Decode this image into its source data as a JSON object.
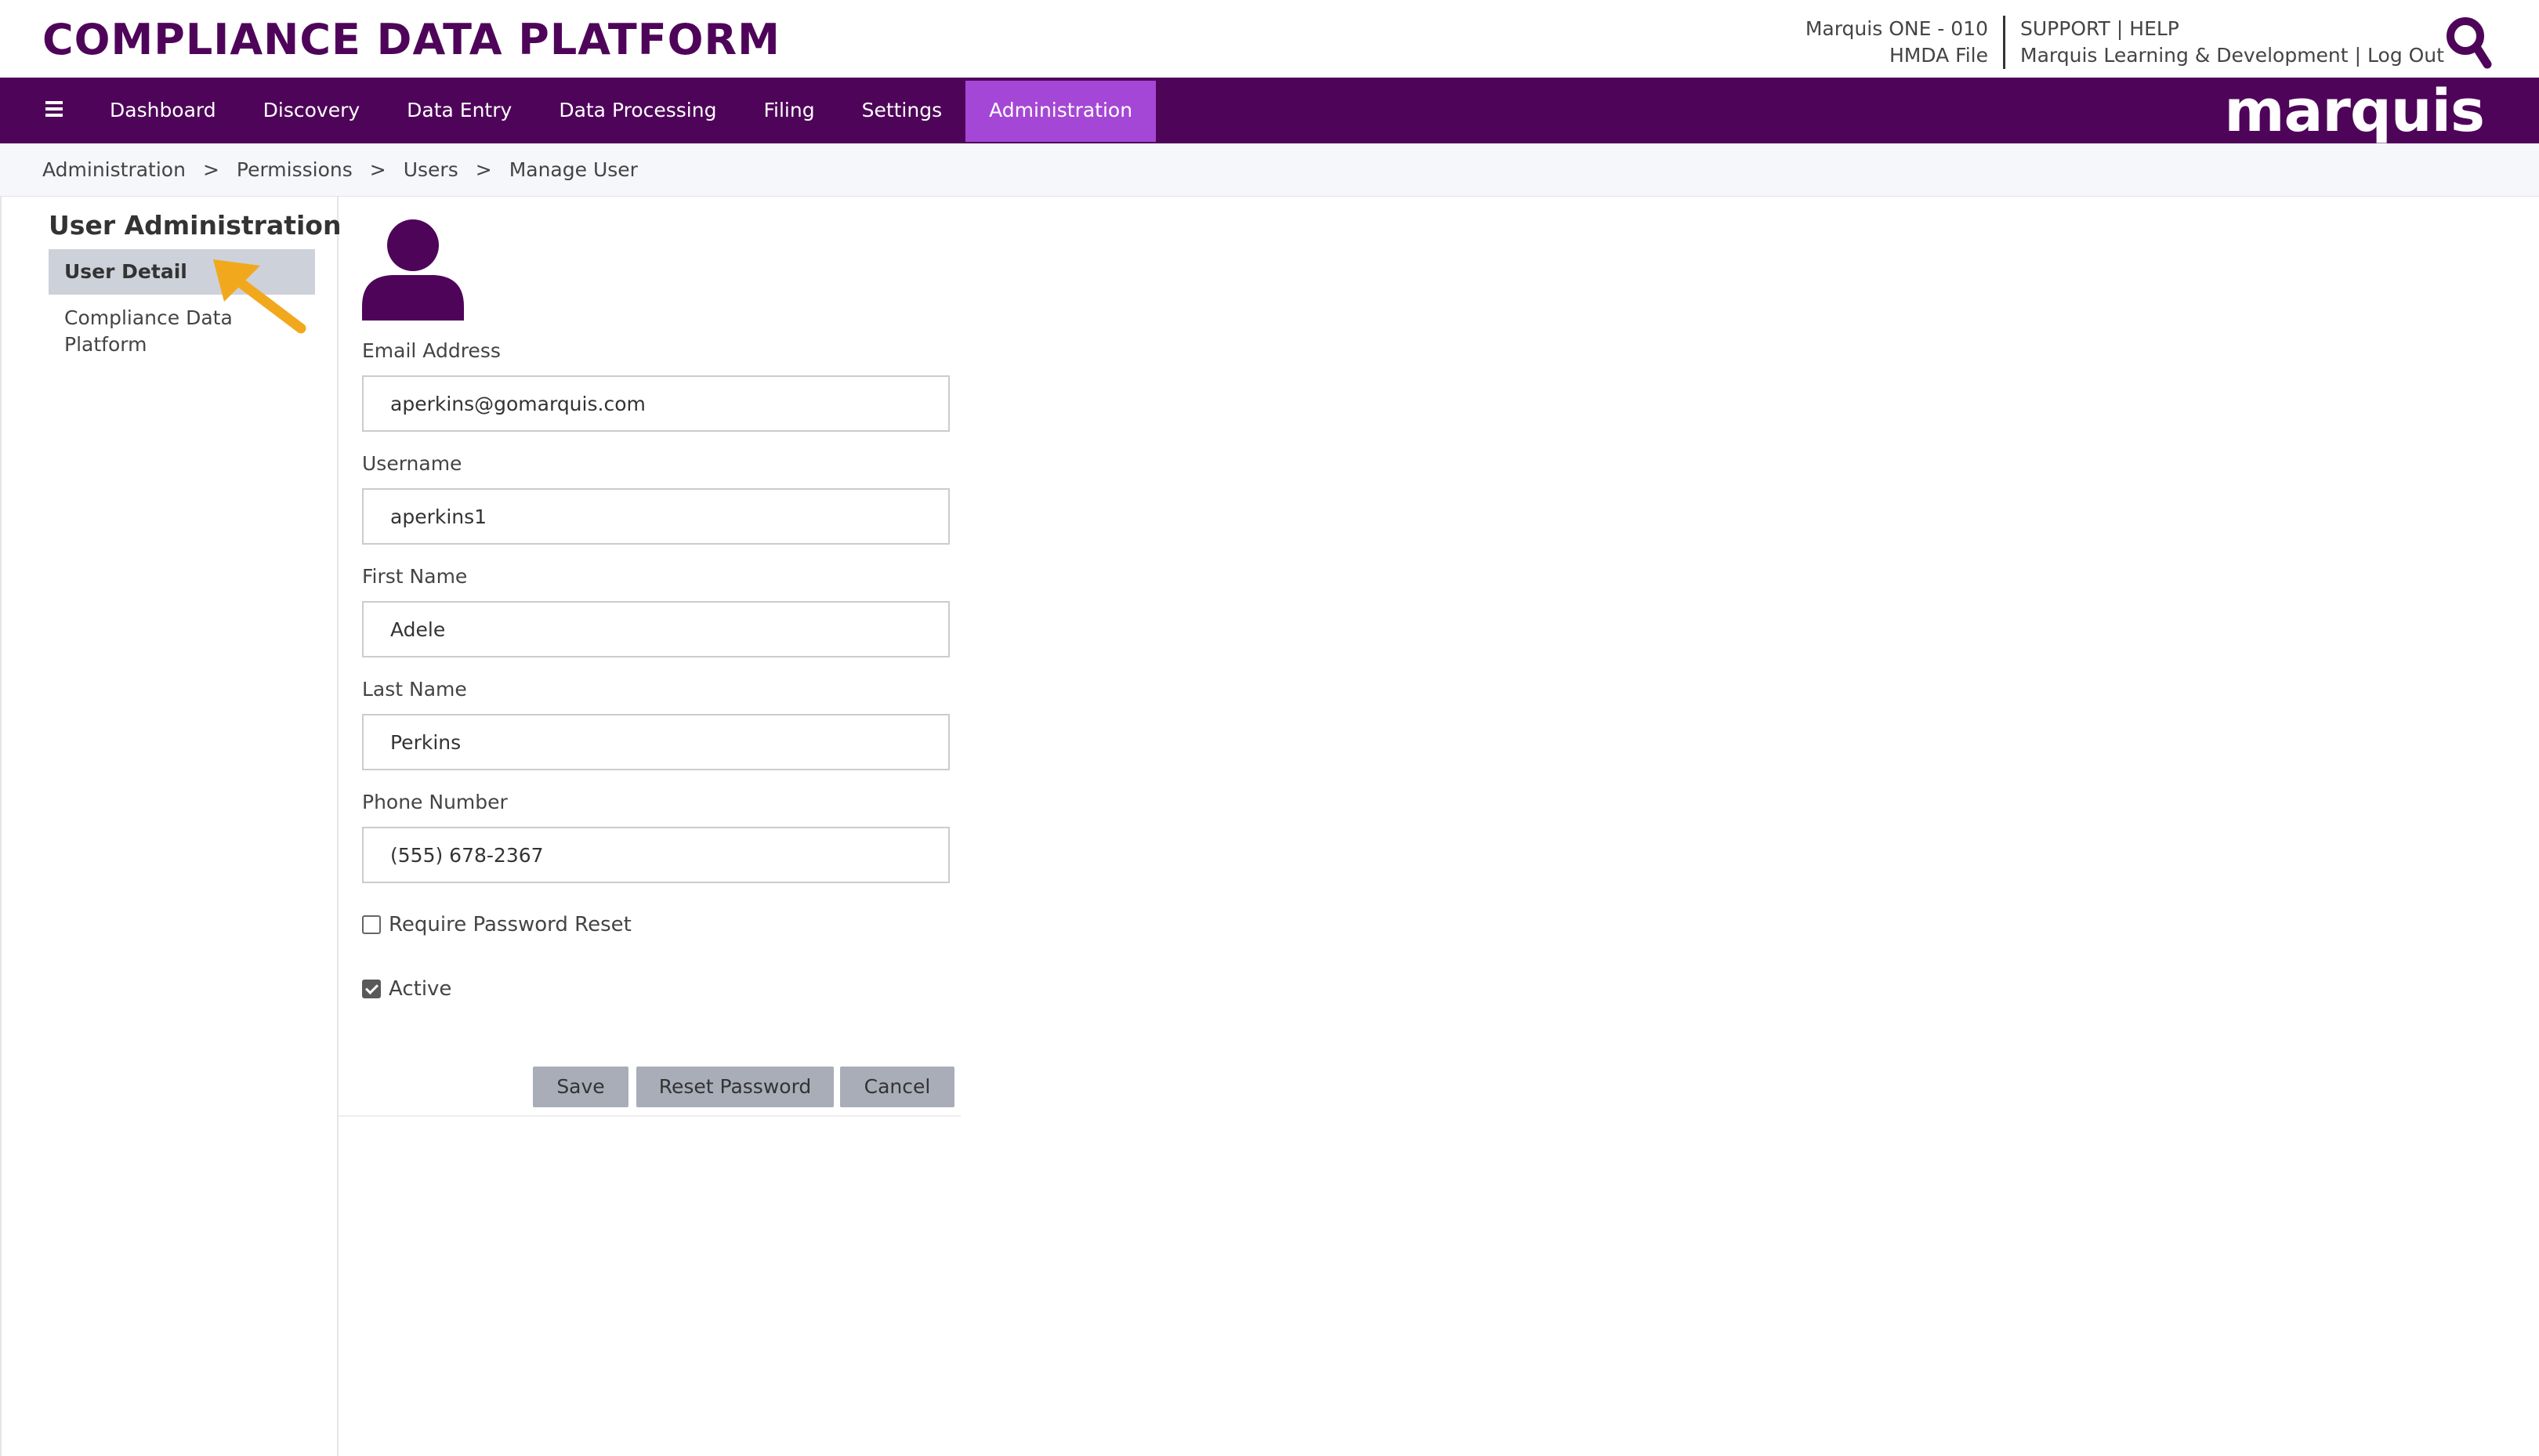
{
  "header": {
    "app_title": "COMPLIANCE DATA PLATFORM",
    "instance": "Marquis ONE - 010",
    "file": "HMDA File",
    "support": "SUPPORT",
    "help": "HELP",
    "separator": "|",
    "organization": "Marquis Learning & Development",
    "logout": "Log Out",
    "search_icon": "search-icon"
  },
  "navbar": {
    "menu_icon": "hamburger-menu-icon",
    "items": [
      {
        "label": "Dashboard"
      },
      {
        "label": "Discovery"
      },
      {
        "label": "Data Entry"
      },
      {
        "label": "Data Processing"
      },
      {
        "label": "Filing"
      },
      {
        "label": "Settings"
      },
      {
        "label": "Administration",
        "active": true
      }
    ],
    "brand": "marquis",
    "color": "#4e0559",
    "active_color": "#a547d6"
  },
  "breadcrumb": {
    "separator": ">",
    "items": [
      "Administration",
      "Permissions",
      "Users",
      "Manage User"
    ]
  },
  "sidebar": {
    "title": "User Administration",
    "items": [
      {
        "label": "User Detail",
        "selected": true
      },
      {
        "label": "Compliance Data Platform"
      }
    ]
  },
  "form": {
    "avatar_icon": "user-avatar-icon",
    "email": {
      "label": "Email Address",
      "value": "aperkins@gomarquis.com"
    },
    "username": {
      "label": "Username",
      "value": "aperkins1"
    },
    "first_name": {
      "label": "First Name",
      "value": "Adele"
    },
    "last_name": {
      "label": "Last Name",
      "value": "Perkins"
    },
    "phone": {
      "label": "Phone Number",
      "value": "(555) 678-2367"
    },
    "require_reset": {
      "label": "Require Password Reset",
      "checked": false
    },
    "active": {
      "label": "Active",
      "checked": true
    },
    "buttons": {
      "save": "Save",
      "reset_password": "Reset Password",
      "cancel": "Cancel"
    }
  },
  "annotation": {
    "icon": "arrow-pointer-icon",
    "color": "#f2a81d"
  }
}
